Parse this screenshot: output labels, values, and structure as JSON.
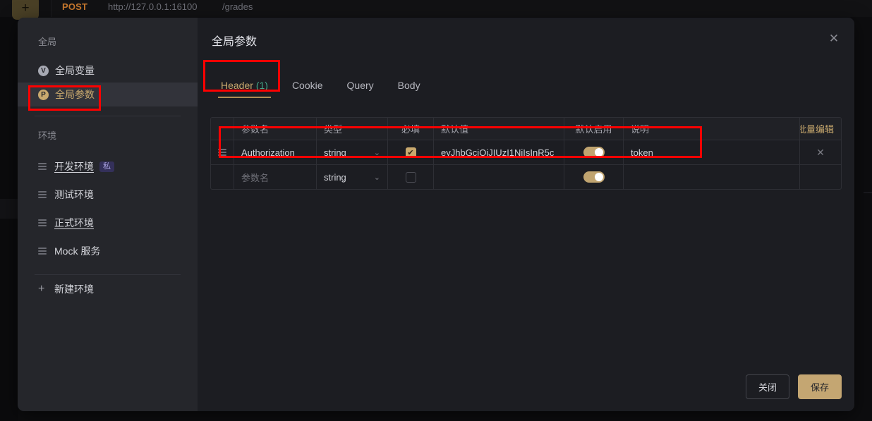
{
  "app": {
    "request_bar": {
      "method": "POST",
      "url": "http://127.0.0.1:16100",
      "path": "/grades",
      "new_tab_label": "+"
    }
  },
  "modal": {
    "title": "全局参数",
    "close_icon": "✕",
    "sidebar": {
      "global_group_label": "全局",
      "global_items": [
        {
          "icon": "V",
          "label": "全局变量",
          "selected": false
        },
        {
          "icon": "P",
          "label": "全局参数",
          "selected": true
        }
      ],
      "env_group_label": "环境",
      "env_items": [
        {
          "label": "开发环境",
          "badge": "私"
        },
        {
          "label": "测试环境",
          "badge": ""
        },
        {
          "label": "正式环境",
          "badge": ""
        },
        {
          "label": "Mock 服务",
          "badge": ""
        }
      ],
      "new_env_label": "新建环境",
      "new_env_icon": "+"
    },
    "tabs": [
      {
        "label": "Header",
        "count": "(1)",
        "active": true
      },
      {
        "label": "Cookie",
        "count": "",
        "active": false
      },
      {
        "label": "Query",
        "count": "",
        "active": false
      },
      {
        "label": "Body",
        "count": "",
        "active": false
      }
    ],
    "table": {
      "bulk_edit_label": "批量编辑",
      "columns": [
        "参数名",
        "类型",
        "必填",
        "默认值",
        "默认启用",
        "说明"
      ],
      "rows": [
        {
          "name": "Authorization",
          "name_placeholder": "参数名",
          "type": "string",
          "required": true,
          "default_value": "eyJhbGciOiJIUzI1NiIsInR5c",
          "enabled": true,
          "description": "token",
          "delete_icon": "✕",
          "is_placeholder_row": false
        },
        {
          "name": "",
          "name_placeholder": "参数名",
          "type": "string",
          "required": false,
          "default_value": "",
          "enabled": true,
          "description": "",
          "delete_icon": "",
          "is_placeholder_row": true
        }
      ]
    },
    "footer": {
      "close_label": "关闭",
      "save_label": "保存"
    }
  },
  "colors": {
    "accent": "#c9a96e",
    "annotation": "#ff0000",
    "method": "#c9792e",
    "count": "#43a98a",
    "badge_private_bg": "#34305a"
  }
}
